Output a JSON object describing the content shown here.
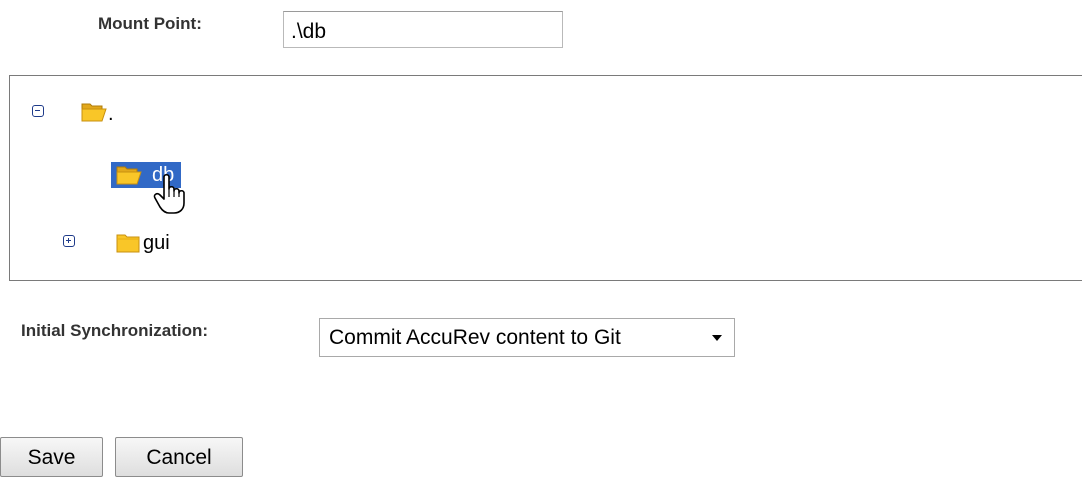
{
  "mount_point": {
    "label": "Mount Point:",
    "value": ".\\db"
  },
  "tree": {
    "root": {
      "label": ".",
      "expanded": true,
      "icon": "folder-open-icon"
    },
    "children": [
      {
        "label": "db",
        "selected": true,
        "icon": "folder-open-icon"
      },
      {
        "label": "gui",
        "expanded": false,
        "icon": "folder-closed-icon"
      }
    ]
  },
  "initial_sync": {
    "label": "Initial Synchronization:",
    "selected": "Commit AccuRev content to Git"
  },
  "buttons": {
    "save": "Save",
    "cancel": "Cancel"
  },
  "colors": {
    "selection": "#3169c6",
    "folder": "#f9c628",
    "toggle": "#1f3b8a"
  }
}
